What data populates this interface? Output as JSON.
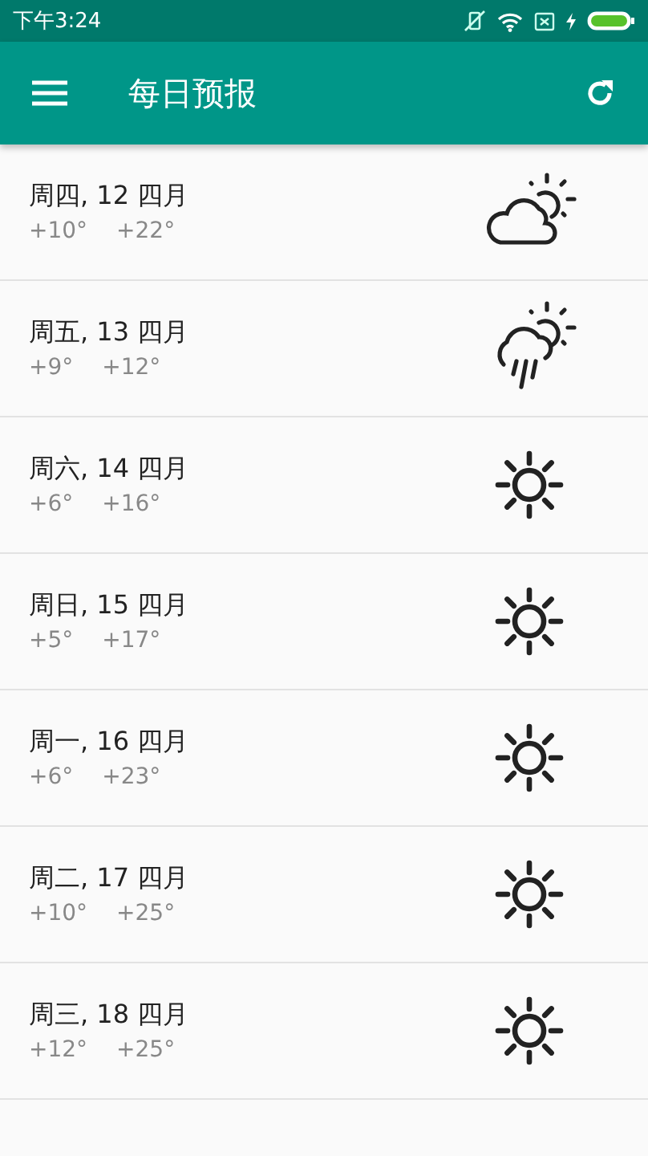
{
  "status_bar": {
    "time": "下午3:24"
  },
  "app_bar": {
    "title": "每日预报"
  },
  "days": [
    {
      "date": "周四, 12 四月",
      "low": "+10°",
      "high": "+22°",
      "kind": "partly-cloudy"
    },
    {
      "date": "周五, 13 四月",
      "low": "+9°",
      "high": "+12°",
      "kind": "rain"
    },
    {
      "date": "周六, 14 四月",
      "low": "+6°",
      "high": "+16°",
      "kind": "sunny"
    },
    {
      "date": "周日, 15 四月",
      "low": "+5°",
      "high": "+17°",
      "kind": "sunny"
    },
    {
      "date": "周一, 16 四月",
      "low": "+6°",
      "high": "+23°",
      "kind": "sunny"
    },
    {
      "date": "周二, 17 四月",
      "low": "+10°",
      "high": "+25°",
      "kind": "sunny"
    },
    {
      "date": "周三, 18 四月",
      "low": "+12°",
      "high": "+25°",
      "kind": "sunny"
    }
  ]
}
